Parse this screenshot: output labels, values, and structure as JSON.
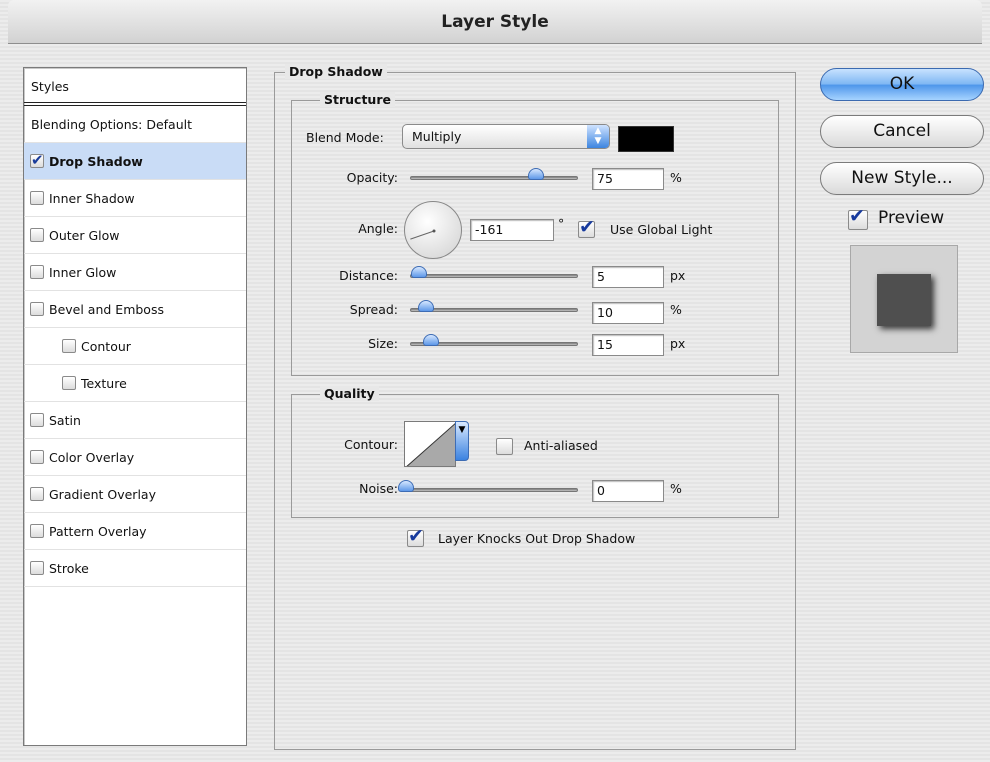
{
  "window": {
    "title": "Layer Style"
  },
  "styles_list": {
    "header": "Styles",
    "items": [
      {
        "label": "Blending Options: Default",
        "checkbox": false,
        "checked": false,
        "indent": false,
        "selected": false
      },
      {
        "label": "Drop Shadow",
        "checkbox": true,
        "checked": true,
        "indent": false,
        "selected": true
      },
      {
        "label": "Inner Shadow",
        "checkbox": true,
        "checked": false,
        "indent": false,
        "selected": false
      },
      {
        "label": "Outer Glow",
        "checkbox": true,
        "checked": false,
        "indent": false,
        "selected": false
      },
      {
        "label": "Inner Glow",
        "checkbox": true,
        "checked": false,
        "indent": false,
        "selected": false
      },
      {
        "label": "Bevel and Emboss",
        "checkbox": true,
        "checked": false,
        "indent": false,
        "selected": false
      },
      {
        "label": "Contour",
        "checkbox": true,
        "checked": false,
        "indent": true,
        "selected": false
      },
      {
        "label": "Texture",
        "checkbox": true,
        "checked": false,
        "indent": true,
        "selected": false
      },
      {
        "label": "Satin",
        "checkbox": true,
        "checked": false,
        "indent": false,
        "selected": false
      },
      {
        "label": "Color Overlay",
        "checkbox": true,
        "checked": false,
        "indent": false,
        "selected": false
      },
      {
        "label": "Gradient Overlay",
        "checkbox": true,
        "checked": false,
        "indent": false,
        "selected": false
      },
      {
        "label": "Pattern Overlay",
        "checkbox": true,
        "checked": false,
        "indent": false,
        "selected": false
      },
      {
        "label": "Stroke",
        "checkbox": true,
        "checked": false,
        "indent": false,
        "selected": false
      }
    ]
  },
  "drop_shadow": {
    "title": "Drop Shadow",
    "structure": {
      "title": "Structure",
      "blend_mode_label": "Blend Mode:",
      "blend_mode_value": "Multiply",
      "shadow_color": "#000000",
      "opacity_label": "Opacity:",
      "opacity_value": "75",
      "opacity_unit": "%",
      "angle_label": "Angle:",
      "angle_value": "-161",
      "angle_unit": "°",
      "use_global_light_label": "Use Global Light",
      "use_global_light_checked": true,
      "distance_label": "Distance:",
      "distance_value": "5",
      "distance_unit": "px",
      "spread_label": "Spread:",
      "spread_value": "10",
      "spread_unit": "%",
      "size_label": "Size:",
      "size_value": "15",
      "size_unit": "px"
    },
    "quality": {
      "title": "Quality",
      "contour_label": "Contour:",
      "anti_aliased_label": "Anti-aliased",
      "anti_aliased_checked": false,
      "noise_label": "Noise:",
      "noise_value": "0",
      "noise_unit": "%"
    },
    "layer_knocks_out_label": "Layer Knocks Out Drop Shadow",
    "layer_knocks_out_checked": true
  },
  "buttons": {
    "ok": "OK",
    "cancel": "Cancel",
    "new_style": "New Style..."
  },
  "preview": {
    "label": "Preview",
    "checked": true
  },
  "colors": {
    "selected_row": "#c9dcf6",
    "accent_blue": "#4c95ea"
  }
}
